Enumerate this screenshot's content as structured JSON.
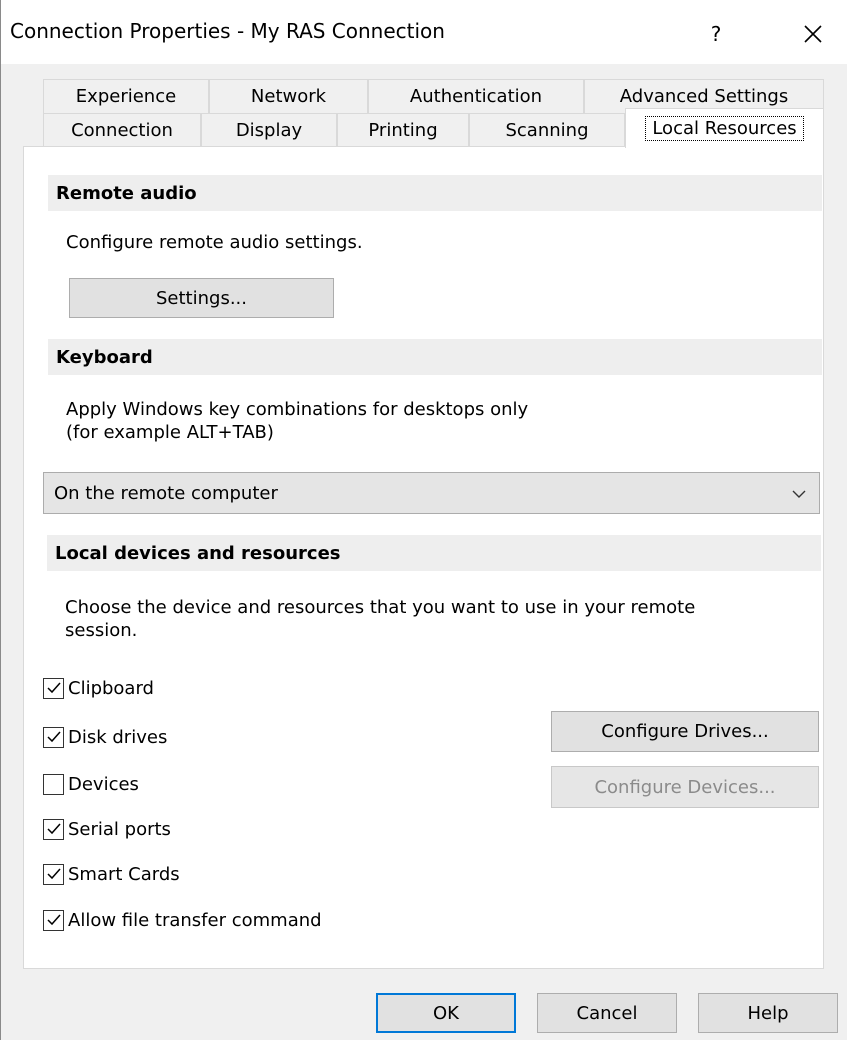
{
  "window": {
    "title": "Connection Properties - My RAS Connection"
  },
  "titlebar": {
    "help": "?",
    "close": "✕"
  },
  "tabs_row1": [
    "Experience",
    "Network",
    "Authentication",
    "Advanced Settings"
  ],
  "tabs_row2": [
    "Connection",
    "Display",
    "Printing",
    "Scanning",
    "Local Resources"
  ],
  "remote_audio": {
    "header": "Remote audio",
    "description": "Configure remote audio settings.",
    "settings_button": "Settings..."
  },
  "keyboard": {
    "header": "Keyboard",
    "description_line1": "Apply Windows key combinations for desktops only",
    "description_line2": "(for example ALT+TAB)",
    "selected": "On the remote computer"
  },
  "local_devices": {
    "header": "Local devices and resources",
    "description_line1": "Choose the device and resources that you want to use in your remote",
    "description_line2": "session.",
    "items": [
      {
        "label": "Clipboard",
        "checked": true
      },
      {
        "label": "Disk drives",
        "checked": true
      },
      {
        "label": "Devices",
        "checked": false
      },
      {
        "label": "Serial ports",
        "checked": true
      },
      {
        "label": "Smart Cards",
        "checked": true
      },
      {
        "label": "Allow file transfer command",
        "checked": true
      }
    ],
    "configure_drives": "Configure Drives...",
    "configure_devices": "Configure Devices..."
  },
  "footer": {
    "ok": "OK",
    "cancel": "Cancel",
    "help": "Help"
  },
  "colors": {
    "accent": "#0078d7",
    "panel": "#ffffff",
    "background": "#f0f0f0"
  }
}
